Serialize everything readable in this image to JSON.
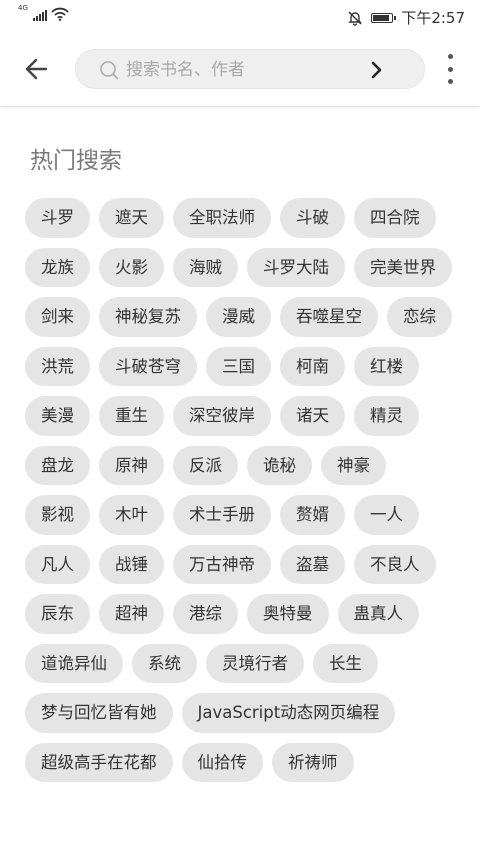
{
  "status_bar": {
    "network": "4G",
    "time": "下午2:57",
    "battery_level": 0.9
  },
  "toolbar": {
    "back_icon": "back-arrow-icon",
    "search": {
      "placeholder": "搜索书名、作者",
      "value": ""
    },
    "go_icon": "chevron-right-icon",
    "more_icon": "more-vert-icon"
  },
  "hot_search": {
    "title": "热门搜索",
    "tags": [
      "斗罗",
      "遮天",
      "全职法师",
      "斗破",
      "四合院",
      "龙族",
      "火影",
      "海贼",
      "斗罗大陆",
      "完美世界",
      "剑来",
      "神秘复苏",
      "漫威",
      "吞噬星空",
      "恋综",
      "洪荒",
      "斗破苍穹",
      "三国",
      "柯南",
      "红楼",
      "美漫",
      "重生",
      "深空彼岸",
      "诸天",
      "精灵",
      "盘龙",
      "原神",
      "反派",
      "诡秘",
      "神豪",
      "影视",
      "木叶",
      "术士手册",
      "赘婿",
      "一人",
      "凡人",
      "战锤",
      "万古神帝",
      "盗墓",
      "不良人",
      "辰东",
      "超神",
      "港综",
      "奥特曼",
      "蛊真人",
      "道诡异仙",
      "系统",
      "灵境行者",
      "长生",
      "梦与回忆皆有她",
      "JavaScript动态网页编程",
      "超级高手在花都",
      "仙拾传",
      "祈祷师"
    ]
  },
  "colors": {
    "tag_bg": "#e5e5e5",
    "search_bg": "#efefef",
    "title": "#7a7a7a"
  }
}
